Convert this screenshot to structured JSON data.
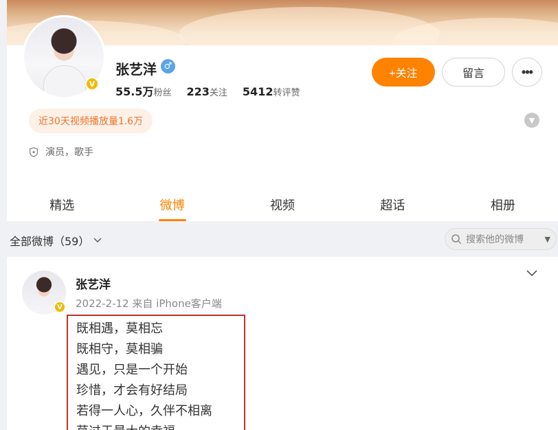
{
  "profile": {
    "name": "张艺洋",
    "gender_symbol": "♂",
    "verified_mark": "V",
    "stats": [
      {
        "value": "55.5万",
        "label": "粉丝"
      },
      {
        "value": "223",
        "label": "关注"
      },
      {
        "value": "5412",
        "label": "转评赞"
      }
    ],
    "follow_label": "+关注",
    "message_label": "留言",
    "more_label": "•••",
    "plays_text": "近30天视频播放量1.6万",
    "tags_text": "演员，歌手"
  },
  "tabs": [
    {
      "label": "精选",
      "active": false
    },
    {
      "label": "微博",
      "active": true
    },
    {
      "label": "视频",
      "active": false
    },
    {
      "label": "超话",
      "active": false
    },
    {
      "label": "相册",
      "active": false
    }
  ],
  "filter": {
    "label": "全部微博（59）",
    "search_placeholder": "搜索他的微博"
  },
  "post": {
    "author": "张艺洋",
    "meta": "2022-2-12 来自 iPhone客户端",
    "lines": [
      "既相遇，莫相忘",
      "既相守，莫相骗",
      "遇见，只是一个开始",
      "珍惜，才会有好结局",
      "若得一人心，久伴不相离",
      "莫过于最大的幸福"
    ]
  },
  "colors": {
    "accent": "#ff8200",
    "highlight_border": "#c0302a",
    "verified": "#f5b800",
    "gender": "#5aa5e8"
  }
}
